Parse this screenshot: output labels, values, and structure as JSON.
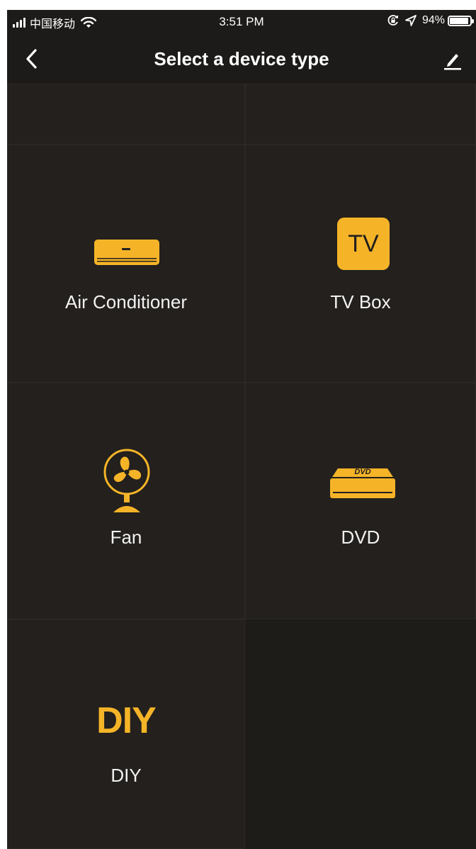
{
  "status_bar": {
    "carrier": "中国移动",
    "time": "3:51 PM",
    "battery_percent": "94%",
    "battery_level": 0.94,
    "icons": [
      "signal-icon",
      "wifi-icon",
      "orientation-lock-icon",
      "location-icon",
      "battery-icon"
    ]
  },
  "nav": {
    "title": "Select a device type",
    "back_icon": "chevron-left-icon",
    "edit_icon": "pencil-icon"
  },
  "devices": [
    {
      "label": "Air Conditioner",
      "icon": "air-conditioner-icon"
    },
    {
      "label": "TV Box",
      "icon": "tv-icon",
      "icon_text": "TV"
    },
    {
      "label": "Fan",
      "icon": "fan-icon"
    },
    {
      "label": "DVD",
      "icon": "dvd-player-icon",
      "icon_text": "DVD"
    },
    {
      "label": "DIY",
      "icon": "diy-icon",
      "icon_text": "DIY"
    }
  ],
  "colors": {
    "accent": "#f5b428",
    "background": "#1f1d1b",
    "cell": "#23201d",
    "text": "#f2f2f2"
  }
}
